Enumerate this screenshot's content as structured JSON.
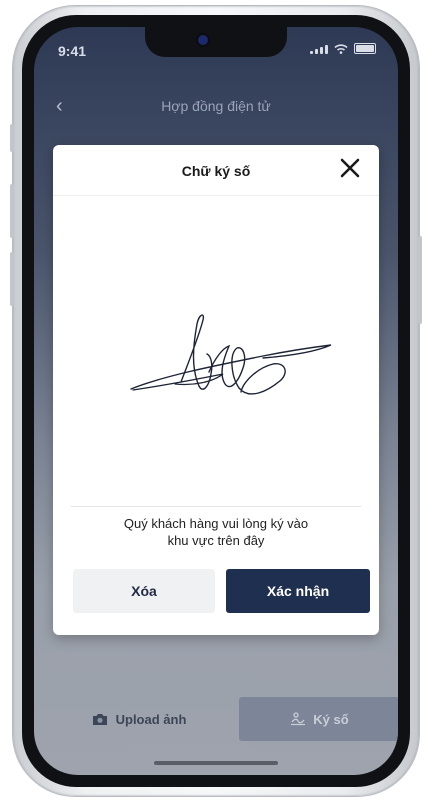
{
  "status_bar": {
    "time": "9:41"
  },
  "nav": {
    "back_icon": "chevron-left-icon",
    "title": "Hợp đồng điện tử"
  },
  "dialog": {
    "title": "Chữ ký số",
    "hint_line1": "Quý khách hàng vui lòng ký vào",
    "hint_line2": "khu vực trên đây",
    "clear_label": "Xóa",
    "confirm_label": "Xác nhận"
  },
  "bottom": {
    "upload_label": "Upload ảnh",
    "sign_label": "Ký số"
  },
  "colors": {
    "primary": "#1f2f50",
    "overlay_top": "#2e3a55",
    "secondary_button": "#f0f1f3"
  }
}
